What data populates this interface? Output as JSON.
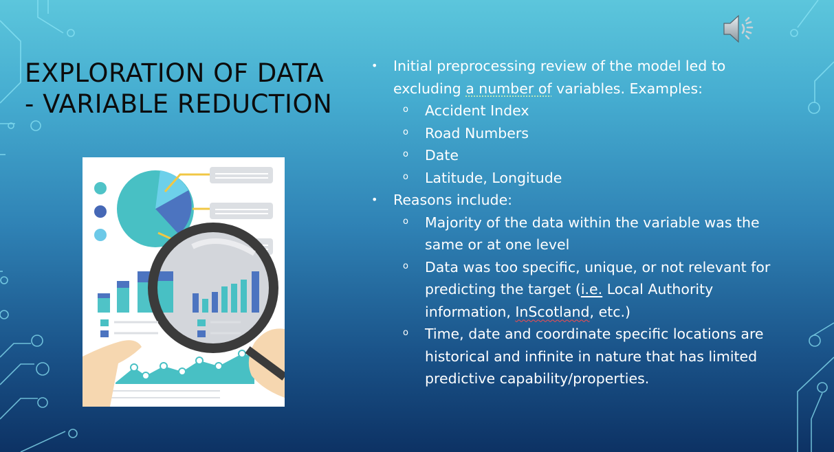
{
  "slide": {
    "title_line1": "EXPLORATION OF DATA",
    "title_line2": "- VARIABLE REDUCTION",
    "speaker_icon": "speaker-audio-icon",
    "illustration": "data-analysis-magnifier-illustration",
    "bullets": {
      "b1_text_a": "Initial preprocessing review of the model led to excluding ",
      "b1_text_underlined": "a number of",
      "b1_text_b": " variables. Examples:",
      "b1_subs": [
        "Accident Index",
        "Road Numbers",
        "Date",
        "Latitude, Longitude"
      ],
      "b2_text": "Reasons include:",
      "b2_sub1": "Majority of the data within the variable was the same or at one level",
      "b2_sub2_a": "Data was too specific, unique, or not relevant for predicting the target (",
      "b2_sub2_ie": "i.e.",
      "b2_sub2_b": " Local Authority information, ",
      "b2_sub2_inscot": "InScotland",
      "b2_sub2_c": ", etc.)",
      "b2_sub3": "Time, date and coordinate specific locations are historical and infinite in nature that has limited predictive capability/properties."
    }
  }
}
